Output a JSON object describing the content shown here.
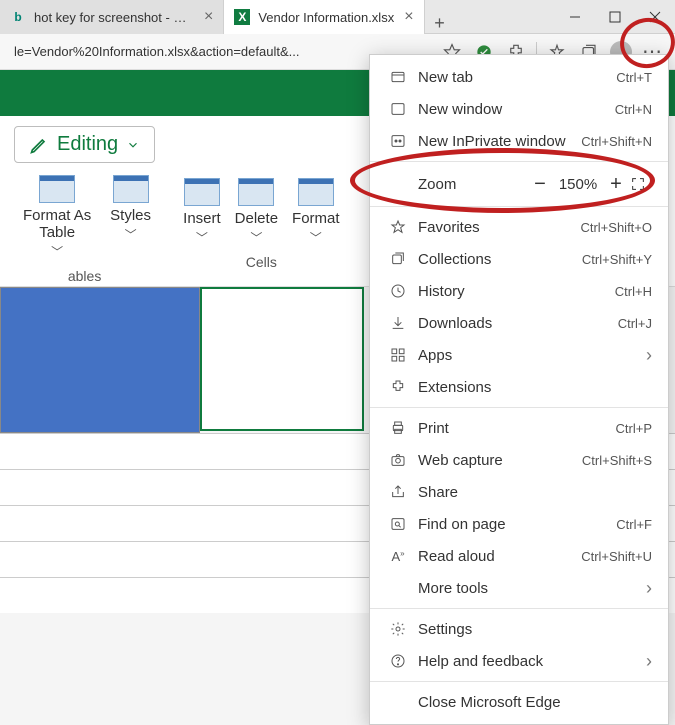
{
  "tabs": [
    {
      "title": "hot key for screenshot - Search"
    },
    {
      "title": "Vendor Information.xlsx"
    }
  ],
  "addressbar": {
    "url": "le=Vendor%20Information.xlsx&action=default&..."
  },
  "ribbon": {
    "editing_label": "Editing",
    "items": {
      "format_as_table": "Format As Table",
      "styles": "Styles",
      "insert": "Insert",
      "delete": "Delete",
      "format": "Format"
    },
    "groups": {
      "tables": "ables",
      "cells": "Cells"
    }
  },
  "menu": {
    "new_tab": {
      "label": "New tab",
      "shortcut": "Ctrl+T"
    },
    "new_window": {
      "label": "New window",
      "shortcut": "Ctrl+N"
    },
    "new_inprivate": {
      "label": "New InPrivate window",
      "shortcut": "Ctrl+Shift+N"
    },
    "zoom": {
      "label": "Zoom",
      "value": "150%"
    },
    "favorites": {
      "label": "Favorites",
      "shortcut": "Ctrl+Shift+O"
    },
    "collections": {
      "label": "Collections",
      "shortcut": "Ctrl+Shift+Y"
    },
    "history": {
      "label": "History",
      "shortcut": "Ctrl+H"
    },
    "downloads": {
      "label": "Downloads",
      "shortcut": "Ctrl+J"
    },
    "apps": {
      "label": "Apps"
    },
    "extensions": {
      "label": "Extensions"
    },
    "print": {
      "label": "Print",
      "shortcut": "Ctrl+P"
    },
    "web_capture": {
      "label": "Web capture",
      "shortcut": "Ctrl+Shift+S"
    },
    "share": {
      "label": "Share"
    },
    "find": {
      "label": "Find on page",
      "shortcut": "Ctrl+F"
    },
    "read_aloud": {
      "label": "Read aloud",
      "shortcut": "Ctrl+Shift+U"
    },
    "more_tools": {
      "label": "More tools"
    },
    "settings": {
      "label": "Settings"
    },
    "help": {
      "label": "Help and feedback"
    },
    "close_edge": {
      "label": "Close Microsoft Edge"
    }
  }
}
